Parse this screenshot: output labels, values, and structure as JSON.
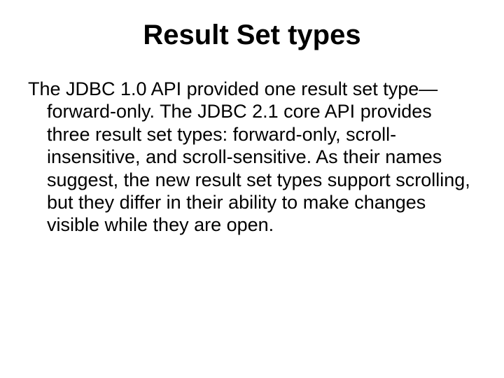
{
  "slide": {
    "title": "Result Set types",
    "body": "The JDBC 1.0 API provided one result set type—forward-only. The JDBC 2.1 core API provides three result set types: forward-only, scroll-insensitive, and scroll-sensitive. As their names suggest, the new result set types support scrolling, but they differ in their ability to make changes visible while they are open."
  }
}
